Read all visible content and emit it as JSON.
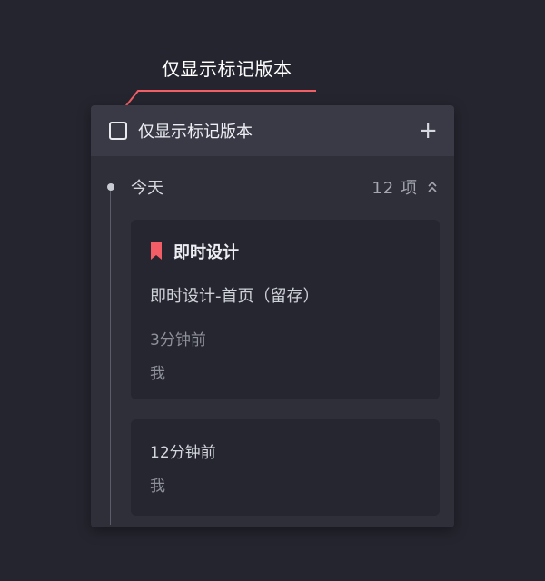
{
  "callout": {
    "text": "仅显示标记版本"
  },
  "panel": {
    "header": {
      "checkbox_label": "仅显示标记版本",
      "add_icon": "plus-icon"
    },
    "group": {
      "day_label": "今天",
      "count_label": "12 项",
      "collapse_icon": "chevron-up-double-icon"
    },
    "cards": [
      {
        "tag_icon": "bookmark-icon",
        "tag_title": "即时设计",
        "version_name": "即时设计-首页（留存）",
        "time": "3分钟前",
        "author": "我"
      },
      {
        "time": "12分钟前",
        "author": "我"
      }
    ]
  },
  "colors": {
    "bookmark": "#f25d66",
    "callout_line": "#f25d66",
    "background": "#24252e",
    "panel": "#2e2f39",
    "header": "#393a46",
    "card": "#25262f"
  }
}
